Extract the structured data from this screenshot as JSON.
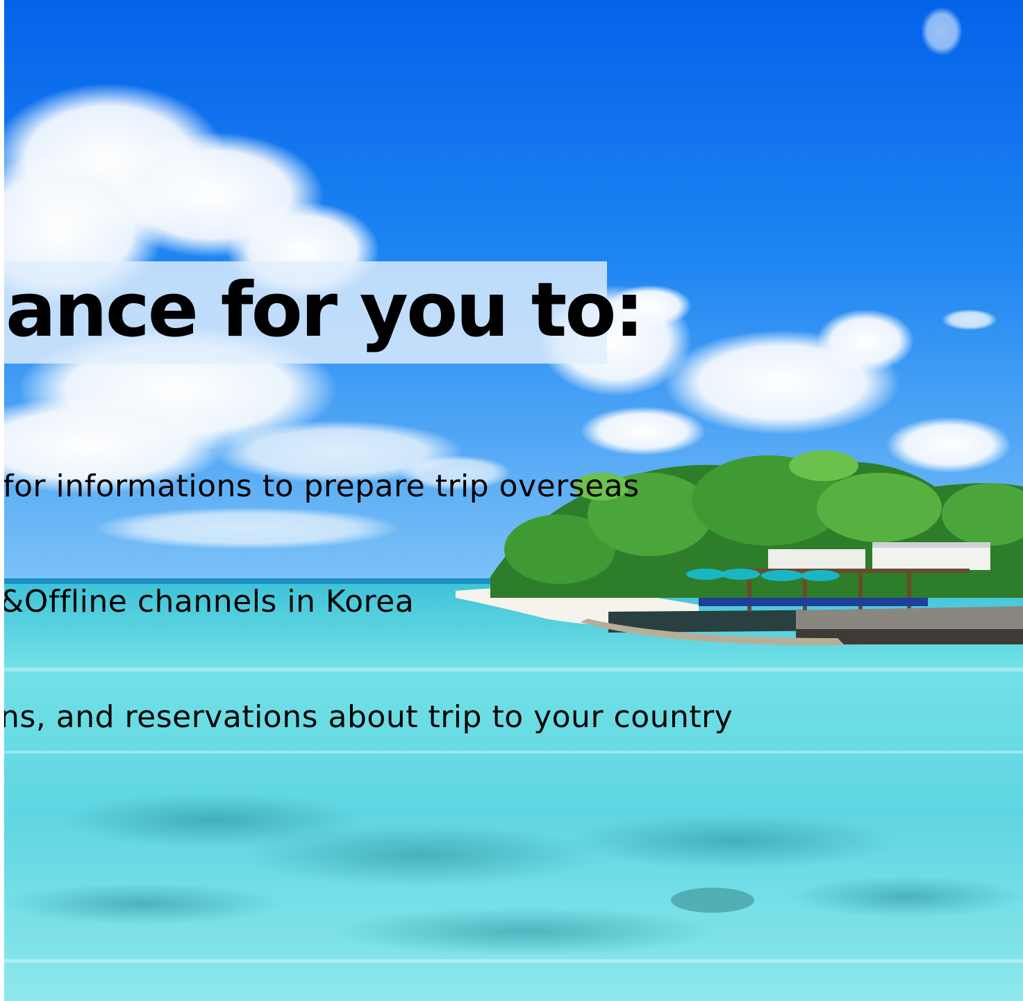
{
  "slide": {
    "heading": "ance for you to:",
    "lines": [
      "for informations to prepare trip overseas",
      "&Offline channels in Korea",
      "ns, and reservations about trip to your country"
    ]
  },
  "background": {
    "image": "tropical-beach-photo",
    "colors": {
      "sky_top": "#0a6ff0",
      "sky_mid": "#2d8ef5",
      "sea_light": "#7fe6ea",
      "sea_deep": "#33c6dc",
      "sand": "#f4f1ea",
      "heading_band": "#e1eefc"
    }
  }
}
